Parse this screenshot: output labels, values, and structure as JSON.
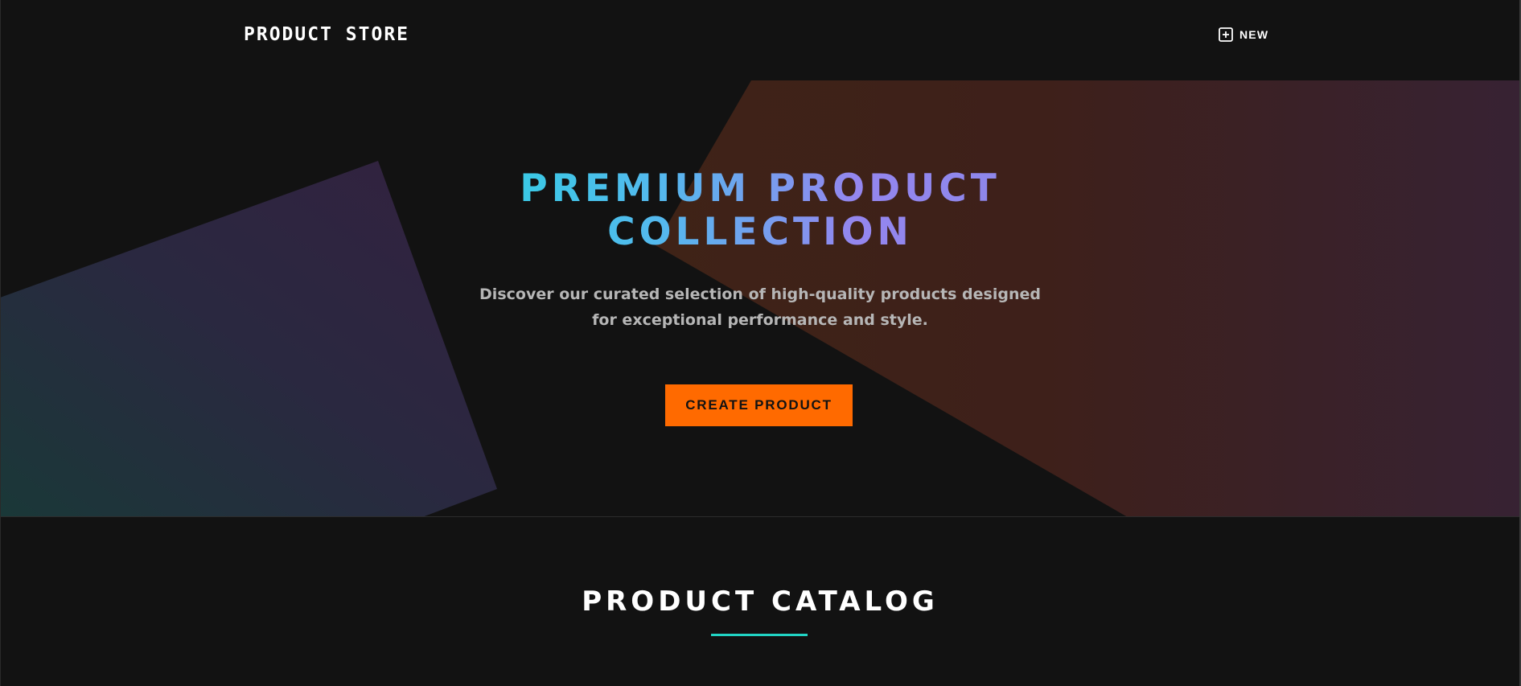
{
  "navbar": {
    "brand": "PRODUCT STORE",
    "new_button": {
      "icon": "plus-square-icon",
      "label": "NEW"
    }
  },
  "hero": {
    "title": "PREMIUM PRODUCT COLLECTION",
    "subtitle": "Discover our curated selection of high-quality products designed for exceptional performance and style.",
    "cta_label": "CREATE PRODUCT"
  },
  "catalog": {
    "title": "PRODUCT CATALOG"
  },
  "colors": {
    "background": "#121212",
    "accent_orange": "#ff6a00",
    "accent_teal": "#21d4c4",
    "title_gradient_start": "#2bd3e0",
    "title_gradient_end": "#8a88ea"
  }
}
